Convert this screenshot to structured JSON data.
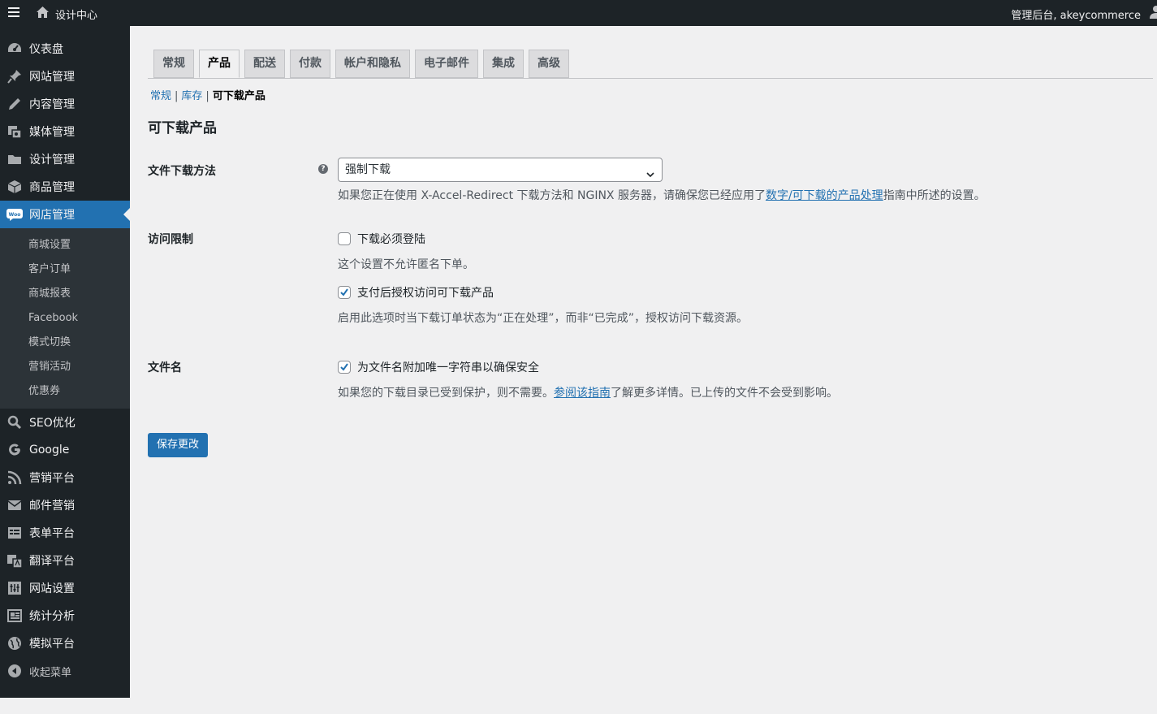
{
  "adminbar": {
    "site_name": "设计中心",
    "account": "管理后台, akeycommerce"
  },
  "sidebar": {
    "items": [
      {
        "label": "仪表盘",
        "icon": "dashboard-icon"
      },
      {
        "label": "网站管理",
        "icon": "pin-icon"
      },
      {
        "label": "内容管理",
        "icon": "edit-icon"
      },
      {
        "label": "媒体管理",
        "icon": "media-icon"
      },
      {
        "label": "设计管理",
        "icon": "folder-icon"
      },
      {
        "label": "商品管理",
        "icon": "box-icon"
      },
      {
        "label": "网店管理",
        "icon": "woo-icon"
      }
    ],
    "woo_badge": "Woo",
    "submenu": [
      "商城设置",
      "客户订单",
      "商城报表",
      "Facebook",
      "模式切换",
      "营销活动",
      "优惠券"
    ],
    "items2": [
      {
        "label": "SEO优化",
        "icon": "search-icon"
      },
      {
        "label": "Google",
        "icon": "google-icon"
      },
      {
        "label": "营销平台",
        "icon": "rss-icon"
      },
      {
        "label": "邮件营销",
        "icon": "email-icon"
      },
      {
        "label": "表单平台",
        "icon": "form-icon"
      },
      {
        "label": "翻译平台",
        "icon": "translate-icon"
      },
      {
        "label": "网站设置",
        "icon": "settings-icon"
      },
      {
        "label": "统计分析",
        "icon": "stats-icon"
      },
      {
        "label": "模拟平台",
        "icon": "globe-icon"
      },
      {
        "label": "收起菜单",
        "icon": "collapse-icon"
      }
    ]
  },
  "tabs": [
    "常规",
    "产品",
    "配送",
    "付款",
    "帐户和隐私",
    "电子邮件",
    "集成",
    "高级"
  ],
  "active_tab": "产品",
  "breadcrumb": {
    "general": "常规",
    "inventory": "库存",
    "separator": "|",
    "current": "可下载产品"
  },
  "section_title": "可下载产品",
  "download_method": {
    "label": "文件下载方法",
    "help": "?",
    "selected": "强制下载",
    "desc_before": "如果您正在使用 X-Accel-Redirect 下载方法和 NGINX 服务器，请确保您已经应用了",
    "desc_link": "数字/可下载的产品处理",
    "desc_after": "指南中所述的设置。"
  },
  "access": {
    "label": "访问限制",
    "require_login": "下载必须登陆",
    "require_login_desc": "这个设置不允许匿名下单。",
    "grant_access": "支付后授权访问可下载产品",
    "grant_access_desc": "启用此选项时当下载订单状态为“正在处理”，而非“已完成”，授权访问下载资源。"
  },
  "filename": {
    "label": "文件名",
    "append_string": "为文件名附加唯一字符串以确保安全",
    "desc_before": "如果您的下载目录已受到保护，则不需要。",
    "desc_link": "参阅该指南",
    "desc_after": "了解更多详情。已上传的文件不会受到影响。"
  },
  "save_label": "保存更改",
  "colors": {
    "accent": "#2271b1",
    "sidebar_bg": "#1d2327",
    "content_bg": "#f0f0f1"
  }
}
